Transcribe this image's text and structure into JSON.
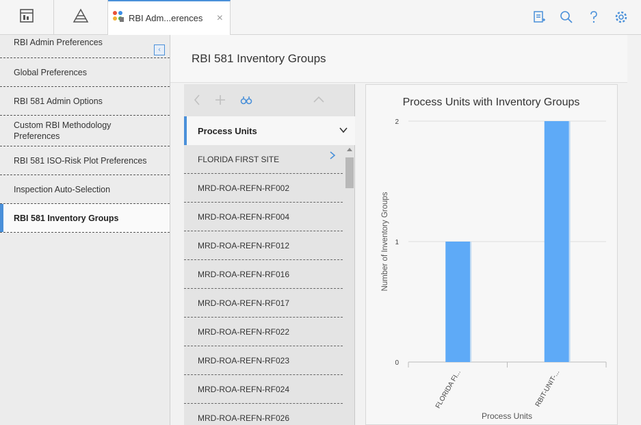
{
  "tab": {
    "label": "RBI Adm...erences",
    "close": "×"
  },
  "sidebar": {
    "items": [
      {
        "label": "RBI Admin Preferences"
      },
      {
        "label": "Global Preferences"
      },
      {
        "label": "RBI 581 Admin Options"
      },
      {
        "label": "Custom RBI Methodology Preferences"
      },
      {
        "label": "RBI 581 ISO-Risk Plot Preferences"
      },
      {
        "label": "Inspection Auto-Selection"
      },
      {
        "label": "RBI 581 Inventory Groups"
      }
    ],
    "active_index": 6
  },
  "page": {
    "title": "RBI 581 Inventory Groups"
  },
  "list": {
    "header": "Process Units",
    "rows": [
      "FLORIDA FIRST SITE",
      "MRD-ROA-REFN-RF002",
      "MRD-ROA-REFN-RF004",
      "MRD-ROA-REFN-RF012",
      "MRD-ROA-REFN-RF016",
      "MRD-ROA-REFN-RF017",
      "MRD-ROA-REFN-RF022",
      "MRD-ROA-REFN-RF023",
      "MRD-ROA-REFN-RF024",
      "MRD-ROA-REFN-RF026"
    ]
  },
  "colors": {
    "accent": "#4a90d9",
    "bar": "#5eaaf7"
  },
  "chart_data": {
    "type": "bar",
    "title": "Process Units with Inventory Groups",
    "xlabel": "Process Units",
    "ylabel": "Number of Inventory Groups",
    "categories": [
      "FLORIDA FI...",
      "RBIT-UNIT-..."
    ],
    "values": [
      1,
      2
    ],
    "yticks": [
      "0",
      "1",
      "2"
    ],
    "ylim": [
      0,
      2
    ],
    "grid": true
  }
}
